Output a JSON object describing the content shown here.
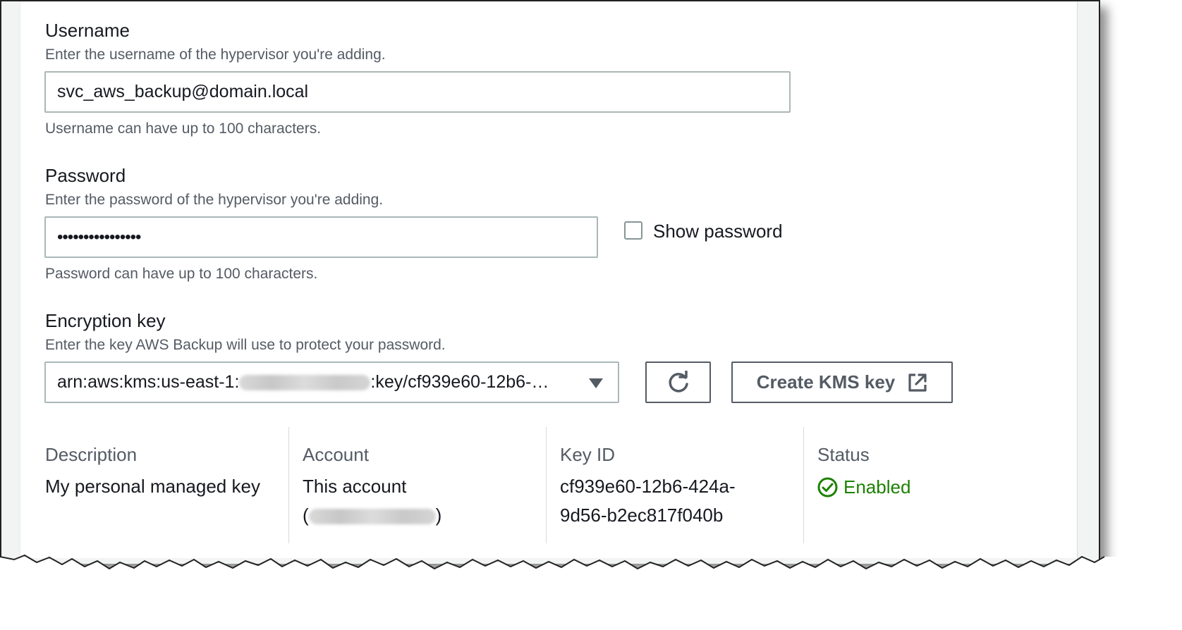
{
  "username": {
    "label": "Username",
    "description": "Enter the username of the hypervisor you're adding.",
    "value": "svc_aws_backup@domain.local",
    "constraint": "Username can have up to 100 characters."
  },
  "password": {
    "label": "Password",
    "description": "Enter the password of the hypervisor you're adding.",
    "value": "••••••••••••••••",
    "show_password_label": "Show password",
    "show_password_checked": false,
    "constraint": "Password can have up to 100 characters."
  },
  "encryption_key": {
    "label": "Encryption key",
    "description": "Enter the key AWS Backup will use to protect your password.",
    "selected_prefix": "arn:aws:kms:us-east-1:",
    "selected_suffix": ":key/cf939e60-12b6-…",
    "refresh_icon": "refresh-icon",
    "create_button_label": "Create KMS key",
    "external_link_icon": "external-link-icon"
  },
  "key_details": {
    "description_title": "Description",
    "description_value": "My personal managed key",
    "account_title": "Account",
    "account_value": "This account",
    "account_open": "(",
    "account_close": ")",
    "key_id_title": "Key ID",
    "key_id_line1": "cf939e60-12b6-424a-",
    "key_id_line2": "9d56-b2ec817f040b",
    "status_title": "Status",
    "status_value": "Enabled",
    "status_color": "#1d8102"
  }
}
